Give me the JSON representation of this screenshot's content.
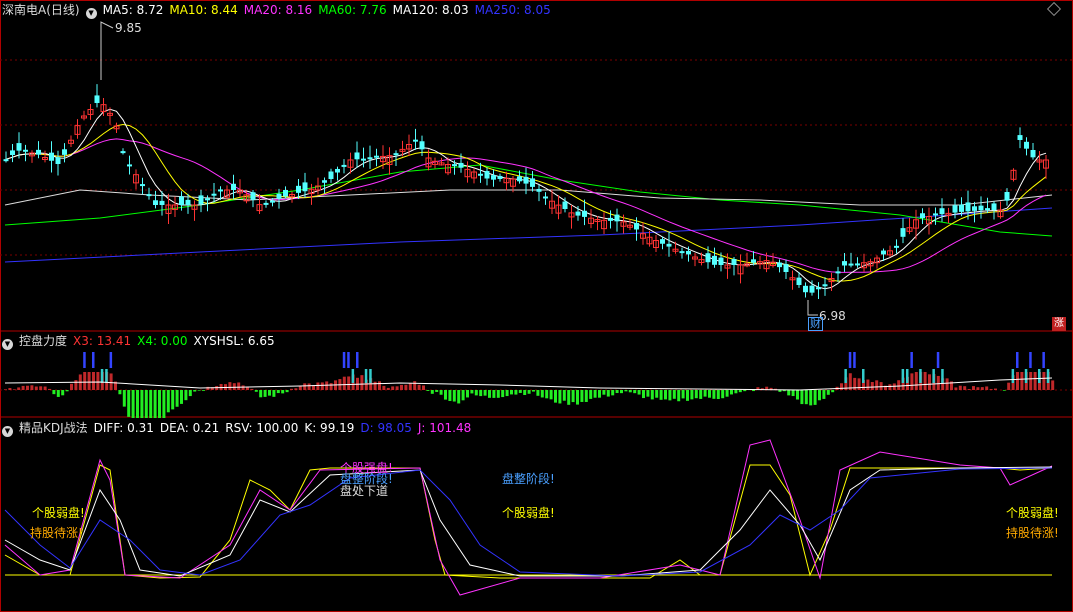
{
  "main_panel": {
    "title": "深南电A(日线)",
    "indicators": [
      {
        "label": "MA5: 8.72",
        "color": "#ffffff"
      },
      {
        "label": "MA10: 8.44",
        "color": "#ffff00"
      },
      {
        "label": "MA20: 8.16",
        "color": "#ff33ff"
      },
      {
        "label": "MA60: 7.76",
        "color": "#00ff00"
      },
      {
        "label": "MA120: 8.03",
        "color": "#ffffff"
      },
      {
        "label": "MA250: 8.05",
        "color": "#3333ff"
      }
    ],
    "high_label": "9.85",
    "low_label": "6.98",
    "cai_badge": "财",
    "zhang_badge": "涨"
  },
  "sub_panel_1": {
    "title": "控盘力度",
    "indicators": [
      {
        "label": "X3: 13.41",
        "color": "#ff3333"
      },
      {
        "label": "X4: 0.00",
        "color": "#00ff00"
      },
      {
        "label": "XYSHSL: 6.65",
        "color": "#ffffff"
      }
    ]
  },
  "sub_panel_2": {
    "title": "精品KDJ战法",
    "indicators": [
      {
        "label": "DIFF: 0.31",
        "color": "#ffffff"
      },
      {
        "label": "DEA: 0.21",
        "color": "#ffffff"
      },
      {
        "label": "RSV: 100.00",
        "color": "#ffffff"
      },
      {
        "label": "K: 99.19",
        "color": "#ffffff"
      },
      {
        "label": "D: 98.05",
        "color": "#3333ff"
      },
      {
        "label": "J: 101.48",
        "color": "#ff33ff"
      }
    ],
    "annotations": {
      "weak_left": "个股弱盘!",
      "hold_left": "持股待涨!",
      "strong": "个股强盘!",
      "consolidate_mid": "盘整阶段!",
      "downtrend": "盘处下道",
      "consolidate_right": "盘整阶段!",
      "weak_mid": "个股弱盘!",
      "weak_right": "个股弱盘!",
      "hold_right": "持股待涨!"
    }
  },
  "colors": {
    "up": "#ff3333",
    "down": "#54ffff",
    "grid": "#7a0000",
    "border": "#b00000",
    "annotation_yellow": "#ffff00",
    "annotation_orange": "#ffaa00",
    "annotation_blue": "#4aa0ff",
    "annotation_magenta": "#ff33ff"
  },
  "chart_data": [
    {
      "type": "candlestick",
      "title": "深南电A(日线)",
      "price_range": [
        6.98,
        9.85
      ],
      "marked_high": 9.85,
      "marked_low": 6.98,
      "series": [
        {
          "name": "MA5",
          "last": 8.72
        },
        {
          "name": "MA10",
          "last": 8.44
        },
        {
          "name": "MA20",
          "last": 8.16
        },
        {
          "name": "MA60",
          "last": 7.76
        },
        {
          "name": "MA120",
          "last": 8.03
        },
        {
          "name": "MA250",
          "last": 8.05
        }
      ]
    },
    {
      "type": "bar",
      "title": "控盘力度",
      "series": [
        {
          "name": "X3",
          "last": 13.41
        },
        {
          "name": "X4",
          "last": 0.0
        },
        {
          "name": "XYSHSL",
          "last": 6.65
        }
      ]
    },
    {
      "type": "line",
      "title": "精品KDJ战法",
      "series": [
        {
          "name": "DIFF",
          "last": 0.31
        },
        {
          "name": "DEA",
          "last": 0.21
        },
        {
          "name": "RSV",
          "last": 100.0
        },
        {
          "name": "K",
          "last": 99.19
        },
        {
          "name": "D",
          "last": 98.05
        },
        {
          "name": "J",
          "last": 101.48
        }
      ]
    }
  ]
}
